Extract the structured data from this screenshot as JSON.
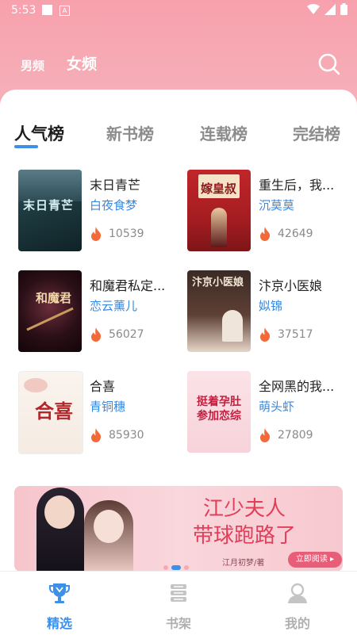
{
  "status_bar": {
    "time": "5:53",
    "a_glyph": "A"
  },
  "gender_tabs": [
    {
      "label": "男频",
      "active": false
    },
    {
      "label": "女频",
      "active": true
    }
  ],
  "rank_tabs": [
    {
      "label": "人气榜",
      "active": true
    },
    {
      "label": "新书榜",
      "active": false
    },
    {
      "label": "连载榜",
      "active": false
    },
    {
      "label": "完结榜",
      "active": false
    }
  ],
  "books": [
    {
      "title": "末日青芒",
      "author": "白夜食梦",
      "hot": "10539",
      "cover_text": "末日青芒"
    },
    {
      "title": "重生后，我...",
      "author": "沉莫莫",
      "hot": "42649",
      "cover_text": "嫁皇叔"
    },
    {
      "title": "和魔君私定...",
      "author": "恋云薰儿",
      "hot": "56027",
      "cover_text": "和魔君"
    },
    {
      "title": "汴京小医娘",
      "author": "姒锦",
      "hot": "37517",
      "cover_text": "汴京小医娘"
    },
    {
      "title": "合喜",
      "author": "青铜穗",
      "hot": "85930",
      "cover_text": "合喜"
    },
    {
      "title": "全网黑的我...",
      "author": "萌头虾",
      "hot": "27809",
      "cover_text": "挺着孕肚参加恋综"
    }
  ],
  "banner": {
    "title_line1": "江少夫人",
    "title_line2": "带球跑路了",
    "author": "江月初梦/著",
    "read_button": "立即阅读 ▸"
  },
  "bottom_nav": [
    {
      "label": "精选",
      "icon": "trophy-icon",
      "active": true
    },
    {
      "label": "书架",
      "icon": "bookshelf-icon",
      "active": false
    },
    {
      "label": "我的",
      "icon": "user-icon",
      "active": false
    }
  ],
  "colors": {
    "header_pink": "#f7a1ad",
    "accent_blue": "#3d8fe8",
    "author_blue": "#3a88db",
    "flame_orange": "#f26a3a"
  }
}
